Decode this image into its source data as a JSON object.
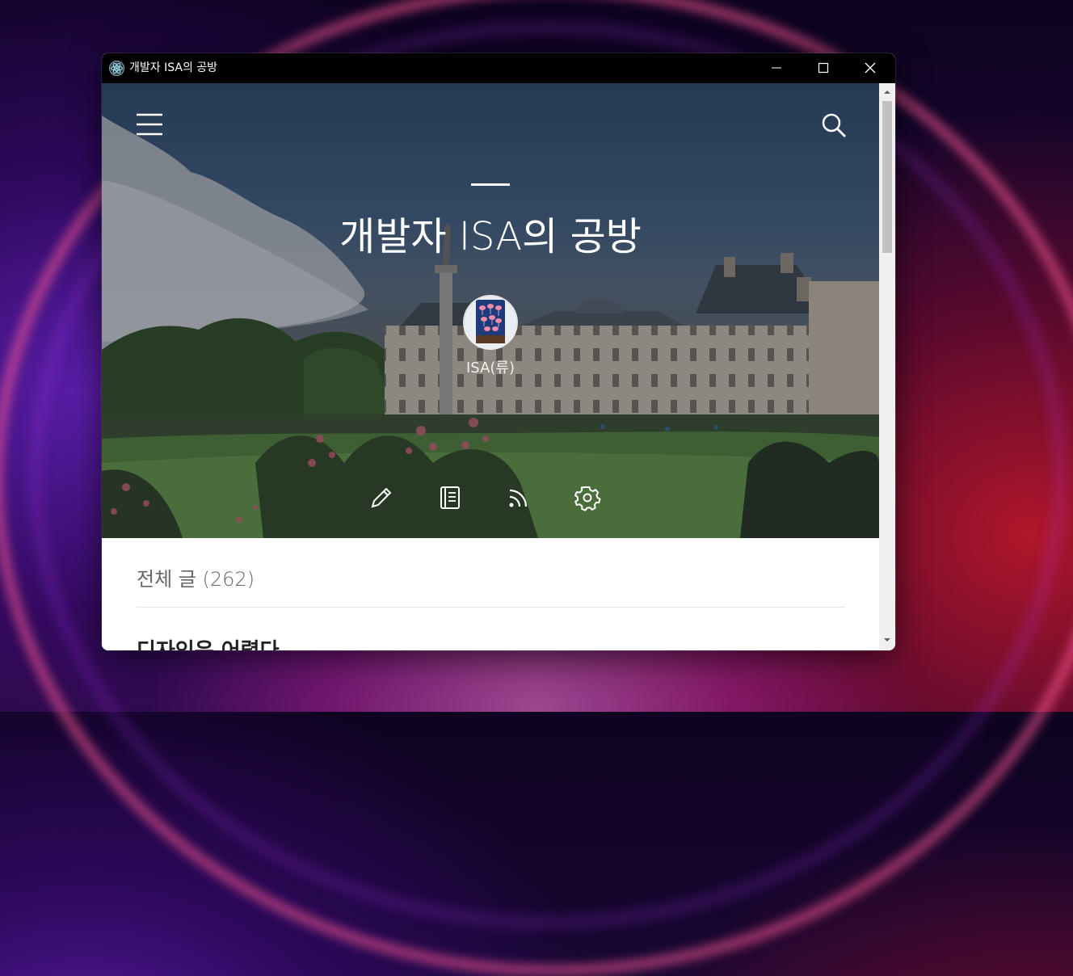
{
  "window": {
    "title": "개발자 ISA의 공방",
    "controls": [
      "minimize",
      "maximize",
      "close"
    ]
  },
  "header": {
    "menu_icon": "hamburger-menu-icon",
    "search_icon": "search-icon"
  },
  "blog": {
    "title": "개발자 ISA의 공방",
    "nickname": "ISA(류)",
    "actions": [
      {
        "name": "write",
        "icon": "pencil-icon"
      },
      {
        "name": "manage",
        "icon": "notebook-icon"
      },
      {
        "name": "rss",
        "icon": "rss-icon"
      },
      {
        "name": "settings",
        "icon": "gear-icon"
      }
    ]
  },
  "main": {
    "section_title": "전체 글 (262)",
    "posts": [
      {
        "title": "디자인은 어렵다"
      }
    ]
  },
  "colors": {
    "titlebar": "#000000",
    "hero_text": "#ffffff",
    "section_title": "#666666",
    "scrollbar_thumb": "#c1c1c1"
  }
}
